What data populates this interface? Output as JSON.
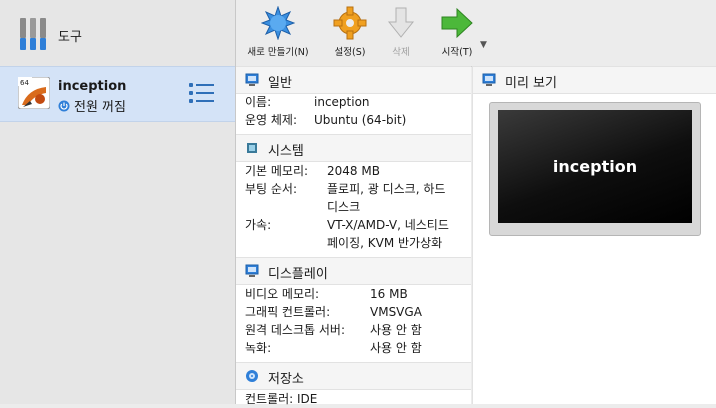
{
  "sidebar": {
    "tools_label": "도구",
    "vm": {
      "badge": "64",
      "name": "inception",
      "state": "전원 꺼짐"
    }
  },
  "toolbar": {
    "new_label": "새로 만들기(N)",
    "settings_label": "설정(S)",
    "delete_label": "삭제",
    "start_label": "시작(T)",
    "dropdown_glyph": "▼"
  },
  "details": {
    "general": {
      "title": "일반",
      "rows": [
        {
          "key": "이름:",
          "value": "inception"
        },
        {
          "key": "운영 체제:",
          "value": "Ubuntu (64-bit)"
        }
      ]
    },
    "system": {
      "title": "시스템",
      "rows": [
        {
          "key": "기본 메모리:",
          "value": "2048 MB"
        },
        {
          "key": "부팅 순서:",
          "value": "플로피, 광 디스크, 하드",
          "value2": "디스크"
        },
        {
          "key": "가속:",
          "value": "VT-X/AMD-V, 네스티드",
          "value2": "페이징, KVM 반가상화"
        }
      ]
    },
    "display": {
      "title": "디스플레이",
      "rows": [
        {
          "key": "비디오 메모리:",
          "value": "16 MB"
        },
        {
          "key": "그래픽 컨트롤러:",
          "value": "VMSVGA"
        },
        {
          "key": "원격 데스크톱 서버:",
          "value": "사용 안 함"
        },
        {
          "key": "녹화:",
          "value": "사용 안 함"
        }
      ]
    },
    "storage": {
      "title": "저장소",
      "rows": [
        {
          "key": "컨트롤러: IDE"
        }
      ]
    }
  },
  "preview": {
    "title": "미리 보기",
    "screen_text": "inception"
  },
  "colors": {
    "selection": "#d4e3f7",
    "accent_blue": "#2f7fd8",
    "start_green": "#4cb83a",
    "settings_orange": "#f0a020"
  }
}
